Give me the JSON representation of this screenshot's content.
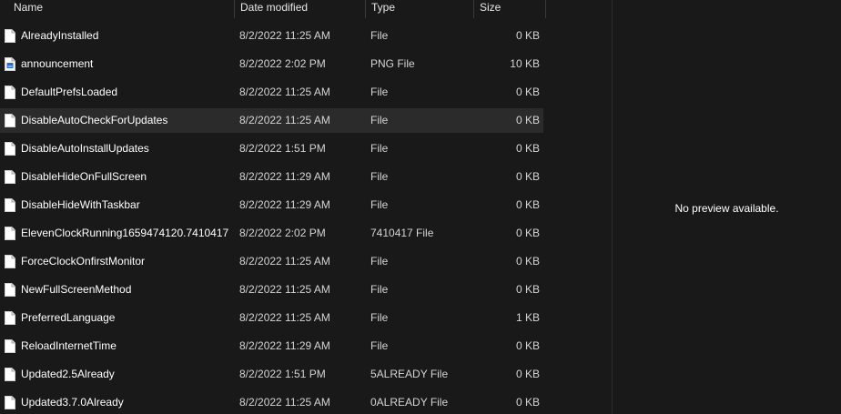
{
  "columns": {
    "name": "Name",
    "date": "Date modified",
    "type": "Type",
    "size": "Size"
  },
  "files": [
    {
      "name": "AlreadyInstalled",
      "date": "8/2/2022 11:25 AM",
      "type": "File",
      "size": "0 KB",
      "icon": "blank-file-icon"
    },
    {
      "name": "announcement",
      "date": "8/2/2022 2:02 PM",
      "type": "PNG File",
      "size": "10 KB",
      "icon": "png-file-icon"
    },
    {
      "name": "DefaultPrefsLoaded",
      "date": "8/2/2022 11:25 AM",
      "type": "File",
      "size": "0 KB",
      "icon": "blank-file-icon"
    },
    {
      "name": "DisableAutoCheckForUpdates",
      "date": "8/2/2022 11:25 AM",
      "type": "File",
      "size": "0 KB",
      "icon": "blank-file-icon"
    },
    {
      "name": "DisableAutoInstallUpdates",
      "date": "8/2/2022 1:51 PM",
      "type": "File",
      "size": "0 KB",
      "icon": "blank-file-icon"
    },
    {
      "name": "DisableHideOnFullScreen",
      "date": "8/2/2022 11:29 AM",
      "type": "File",
      "size": "0 KB",
      "icon": "blank-file-icon"
    },
    {
      "name": "DisableHideWithTaskbar",
      "date": "8/2/2022 11:29 AM",
      "type": "File",
      "size": "0 KB",
      "icon": "blank-file-icon"
    },
    {
      "name": "ElevenClockRunning1659474120.7410417",
      "date": "8/2/2022 2:02 PM",
      "type": "7410417 File",
      "size": "0 KB",
      "icon": "blank-file-icon"
    },
    {
      "name": "ForceClockOnfirstMonitor",
      "date": "8/2/2022 11:25 AM",
      "type": "File",
      "size": "0 KB",
      "icon": "blank-file-icon"
    },
    {
      "name": "NewFullScreenMethod",
      "date": "8/2/2022 11:25 AM",
      "type": "File",
      "size": "0 KB",
      "icon": "blank-file-icon"
    },
    {
      "name": "PreferredLanguage",
      "date": "8/2/2022 11:25 AM",
      "type": "File",
      "size": "1 KB",
      "icon": "blank-file-icon"
    },
    {
      "name": "ReloadInternetTime",
      "date": "8/2/2022 11:29 AM",
      "type": "File",
      "size": "0 KB",
      "icon": "blank-file-icon"
    },
    {
      "name": "Updated2.5Already",
      "date": "8/2/2022 1:51 PM",
      "type": "5ALREADY File",
      "size": "0 KB",
      "icon": "blank-file-icon"
    },
    {
      "name": "Updated3.7.0Already",
      "date": "8/2/2022 11:25 AM",
      "type": "0ALREADY File",
      "size": "0 KB",
      "icon": "blank-file-icon"
    }
  ],
  "hovered_row": 3,
  "preview": {
    "message": "No preview available."
  },
  "colors": {
    "background": "#191919",
    "hover": "#2b2b2b",
    "text": "#ffffff"
  }
}
